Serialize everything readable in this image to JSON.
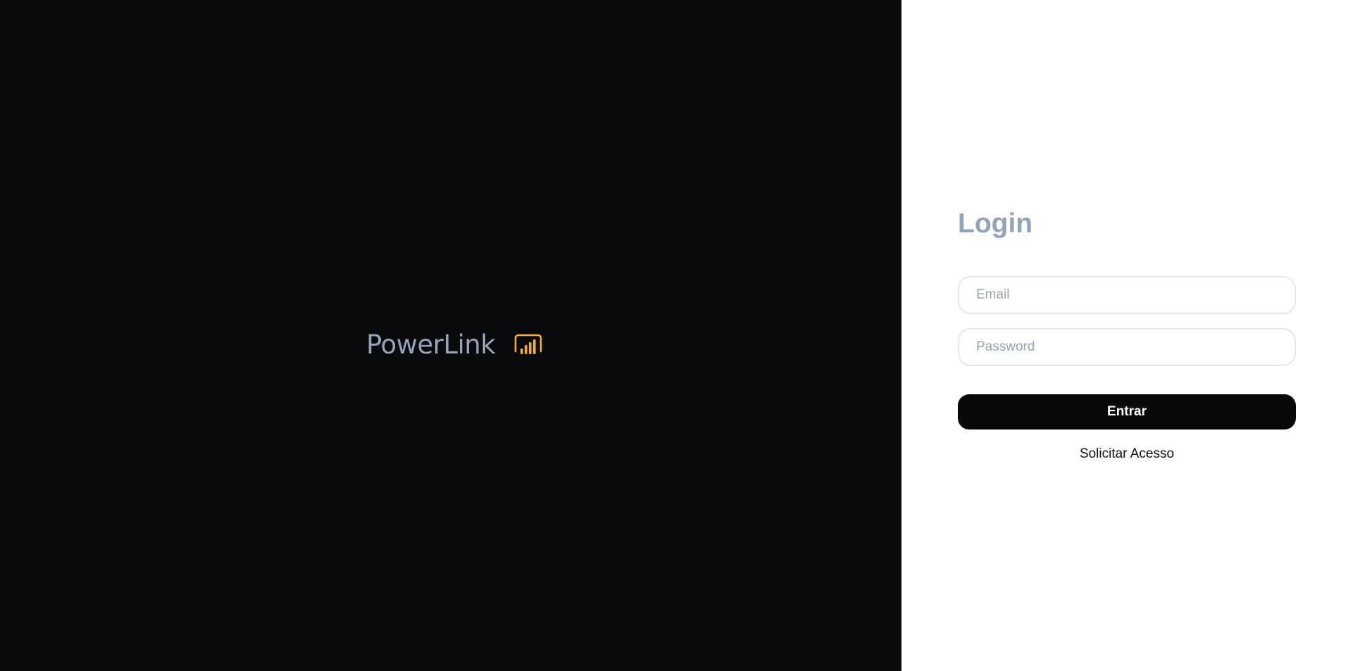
{
  "brand": {
    "name": "PowerLink",
    "logo_icon": "bar-chart-icon",
    "logo_color": "#f2b01e",
    "panel_background": "#0a0a0c"
  },
  "login": {
    "title": "Login",
    "email": {
      "placeholder": "Email",
      "value": ""
    },
    "password": {
      "placeholder": "Password",
      "value": ""
    },
    "submit_label": "Entrar",
    "request_access_label": "Solicitar Acesso",
    "title_color": "#94a3b8",
    "button_color": "#09090b"
  }
}
